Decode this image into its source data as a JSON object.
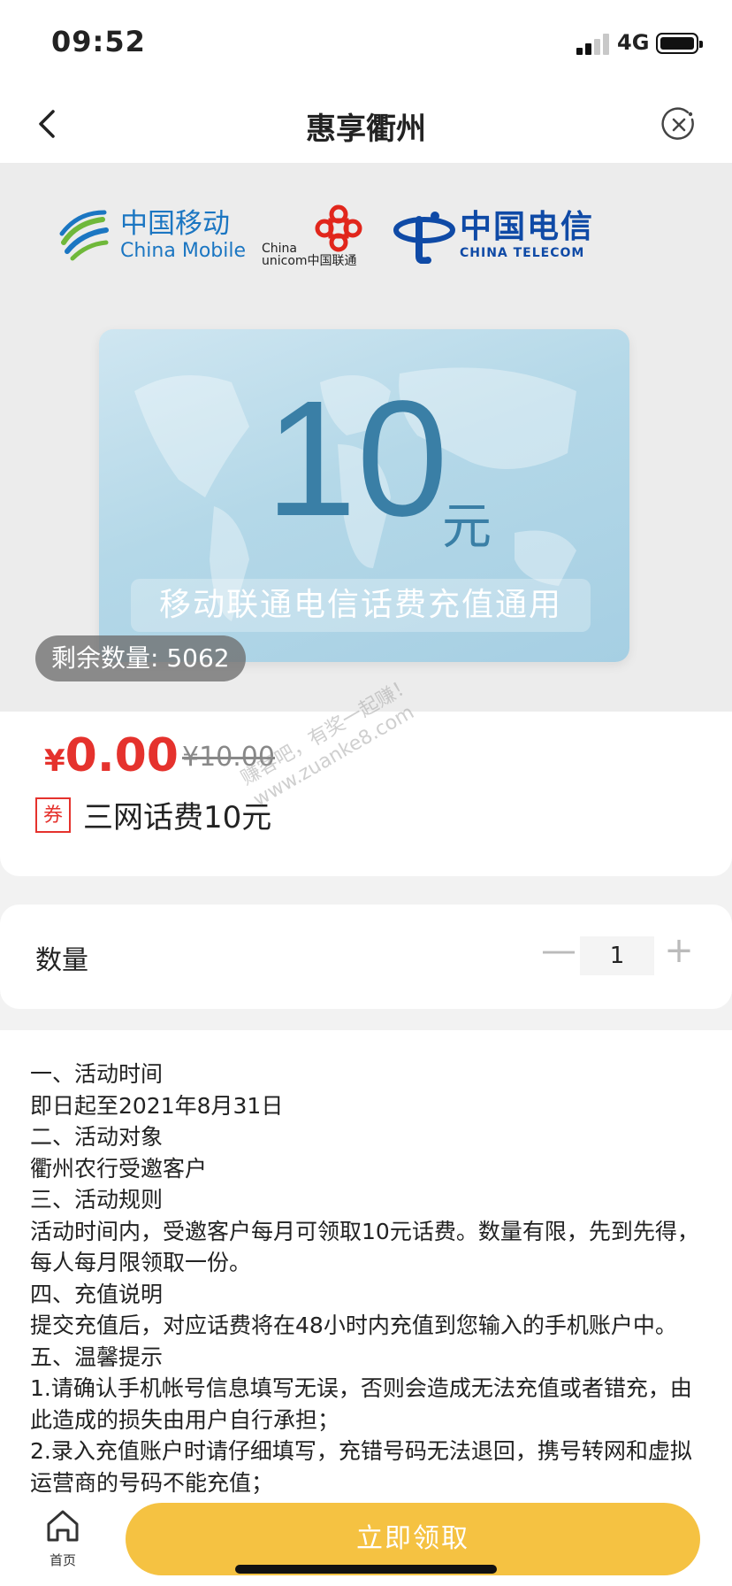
{
  "status_bar": {
    "time": "09:52",
    "network": "4G"
  },
  "nav": {
    "title": "惠享衢州",
    "back_icon": "chevron-left-icon",
    "close_icon": "close-circle-icon"
  },
  "carriers": {
    "china_mobile": {
      "cn": "中国移动",
      "en": "China Mobile"
    },
    "china_unicom": {
      "en_top": "China",
      "en_bottom": "unicom中国联通"
    },
    "china_telecom": {
      "cn": "中国电信",
      "en": "CHINA TELECOM"
    }
  },
  "voucher_card": {
    "amount": "10",
    "unit": "元",
    "subtitle": "移动联通电信话费充值通用"
  },
  "stock_badge": "剩余数量: 5062",
  "price": {
    "currency": "¥",
    "value": "0.00",
    "original": "¥10.00"
  },
  "coupon": {
    "tag": "券",
    "name": "三网话费10元"
  },
  "watermark": {
    "line1": "赚客吧，有奖一起赚！",
    "line2": "www.zuanke8.com"
  },
  "quantity": {
    "label": "数量",
    "value": "1",
    "minus": "—",
    "plus": "+"
  },
  "rules": [
    "一、活动时间",
    "即日起至2021年8月31日",
    "二、活动对象",
    "衢州农行受邀客户",
    "三、活动规则",
    "活动时间内，受邀客户每月可领取10元话费。数量有限，先到先得，每人每月限领取一份。",
    "四、充值说明",
    "提交充值后，对应话费将在48小时内充值到您输入的手机账户中。",
    "五、温馨提示",
    "1.请确认手机帐号信息填写无误，否则会造成无法充值或者错充，由此造成的损失由用户自行承担；",
    "2.录入充值账户时请仔细填写，充错号码无法退回，携号转网和虚拟运营商的号码不能充值；"
  ],
  "bottom_bar": {
    "home_label": "首页",
    "claim_button": "立即领取"
  },
  "colors": {
    "price_red": "#e5322d",
    "button_yellow": "#f5c242",
    "card_blue": "#3a7fa6"
  }
}
